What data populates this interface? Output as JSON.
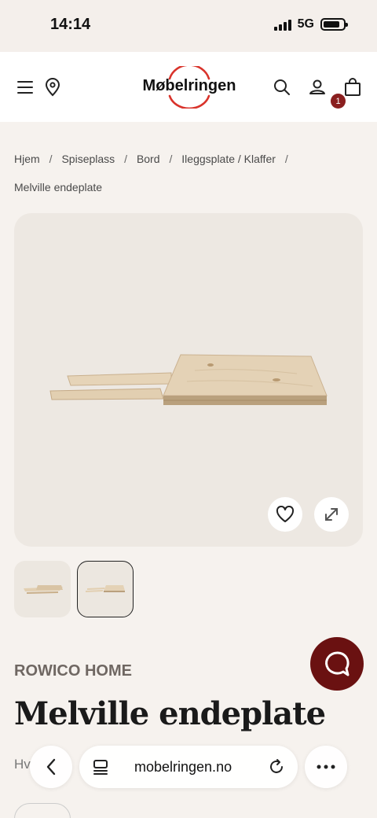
{
  "status": {
    "time": "14:14",
    "network": "5G",
    "battery_level": 0.85,
    "signal_bars": 4
  },
  "header": {
    "logo_text": "Møbelringen",
    "cart_count": "1",
    "icons": [
      "menu-icon",
      "location-pin-icon",
      "search-icon",
      "user-icon",
      "shopping-bag-icon"
    ]
  },
  "breadcrumb": [
    "Hjem",
    "Spiseplass",
    "Bord",
    "Ileggsplate / Klaffer",
    "Melville endeplate"
  ],
  "product": {
    "brand": "ROWICO HOME",
    "title": "Melville endeplate",
    "subtitle_visible": "Hv"
  },
  "gallery": {
    "thumbnail_count": 2,
    "selected_thumbnail": 2
  },
  "browser": {
    "url": "mobelringen.no"
  },
  "colors": {
    "brand_red": "#d9332b",
    "chat_button": "#6a1111",
    "badge": "#8a1f1f",
    "background": "#f6f2ee"
  }
}
